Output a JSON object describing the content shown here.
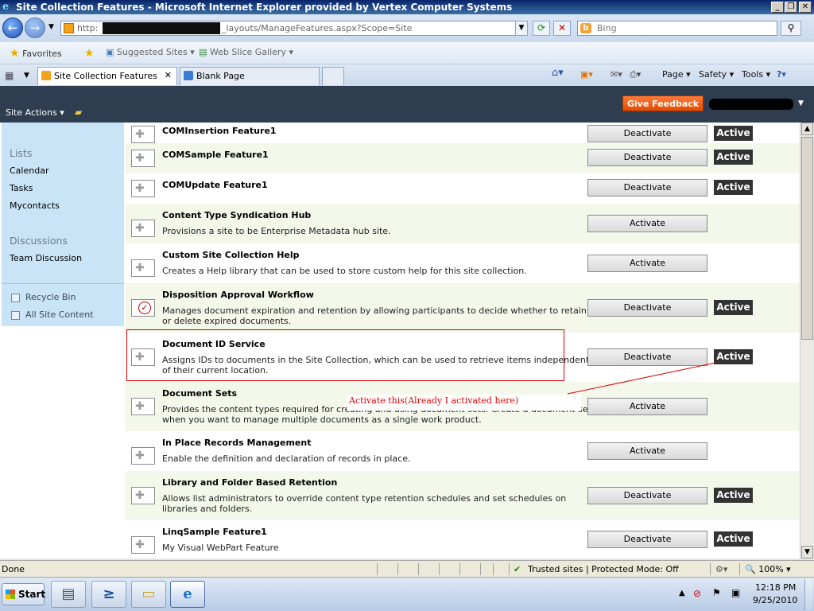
{
  "window": {
    "title": "Site Collection Features - Microsoft Internet Explorer provided by Vertex Computer Systems"
  },
  "address": {
    "url_prefix": "http:",
    "url_suffix": "_layouts/ManageFeatures.aspx?Scope=Site",
    "search_placeholder": "Bing"
  },
  "favorites": {
    "favorites_label": "Favorites",
    "suggested_sites": "Suggested Sites",
    "web_slice_gallery": "Web Slice Gallery"
  },
  "tabs": [
    {
      "label": "Site Collection Features",
      "active": true
    },
    {
      "label": "Blank Page",
      "active": false
    }
  ],
  "commandbar": {
    "page": "Page",
    "safety": "Safety",
    "tools": "Tools"
  },
  "ribbon": {
    "site_actions": "Site Actions",
    "give_feedback": "Give Feedback"
  },
  "leftnav": {
    "lists_heading": "Lists",
    "lists": [
      "Calendar",
      "Tasks",
      "Mycontacts"
    ],
    "discussions_heading": "Discussions",
    "discussions": [
      "Team Discussion"
    ],
    "recycle_bin": "Recycle Bin",
    "all_site_content": "All Site Content"
  },
  "features": [
    {
      "title": "COMInsertion Feature1",
      "desc": "",
      "button": "Deactivate",
      "status": "Active",
      "icon": "puzzle-icon"
    },
    {
      "title": "COMSample Feature1",
      "desc": "",
      "button": "Deactivate",
      "status": "Active",
      "icon": "puzzle-icon"
    },
    {
      "title": "COMUpdate Feature1",
      "desc": "",
      "button": "Deactivate",
      "status": "Active",
      "icon": "puzzle-icon"
    },
    {
      "title": "Content Type Syndication Hub",
      "desc": "Provisions a site to be Enterprise Metadata hub site.",
      "button": "Activate",
      "status": "",
      "icon": "puzzle-icon"
    },
    {
      "title": "Custom Site Collection Help",
      "desc": "Creates a Help library that can be used to store custom help for this site collection.",
      "button": "Activate",
      "status": "",
      "icon": "puzzle-icon"
    },
    {
      "title": "Disposition Approval Workflow",
      "desc": "Manages document expiration and retention by allowing participants to decide whether to retain or delete expired documents.",
      "button": "Deactivate",
      "status": "Active",
      "icon": "workflow-check-icon"
    },
    {
      "title": "Document ID Service",
      "desc": "Assigns IDs to documents in the Site Collection, which can be used to retrieve items independent of their current location.",
      "button": "Deactivate",
      "status": "Active",
      "icon": "puzzle-icon"
    },
    {
      "title": "Document Sets",
      "desc": "Provides the content types required for creating and using document sets. Create a document set when you want to manage multiple documents as a single work product.",
      "button": "Activate",
      "status": "",
      "icon": "puzzle-icon"
    },
    {
      "title": "In Place Records Management",
      "desc": "Enable the definition and declaration of records in place.",
      "button": "Activate",
      "status": "",
      "icon": "puzzle-icon"
    },
    {
      "title": "Library and Folder Based Retention",
      "desc": "Allows list administrators to override content type retention schedules and set schedules on libraries and folders.",
      "button": "Deactivate",
      "status": "Active",
      "icon": "puzzle-icon"
    },
    {
      "title": "LinqSample Feature1",
      "desc": "My Visual WebPart Feature",
      "button": "Deactivate",
      "status": "Active",
      "icon": "puzzle-icon"
    }
  ],
  "annotation": {
    "label": "Activate this(Already I activated here)",
    "color": "#e00000"
  },
  "statusbar": {
    "done": "Done",
    "zone": "Trusted sites | Protected Mode: Off",
    "zoom": "100%"
  },
  "taskbar": {
    "start": "Start",
    "time": "12:18 PM",
    "date": "9/25/2010"
  },
  "colors": {
    "ribbon": "#2e3d50",
    "feedback": "#e14b00",
    "active_badge": "#333333",
    "nav_panel": "#c9e4f7",
    "alt_row": "#f3f8ea"
  }
}
